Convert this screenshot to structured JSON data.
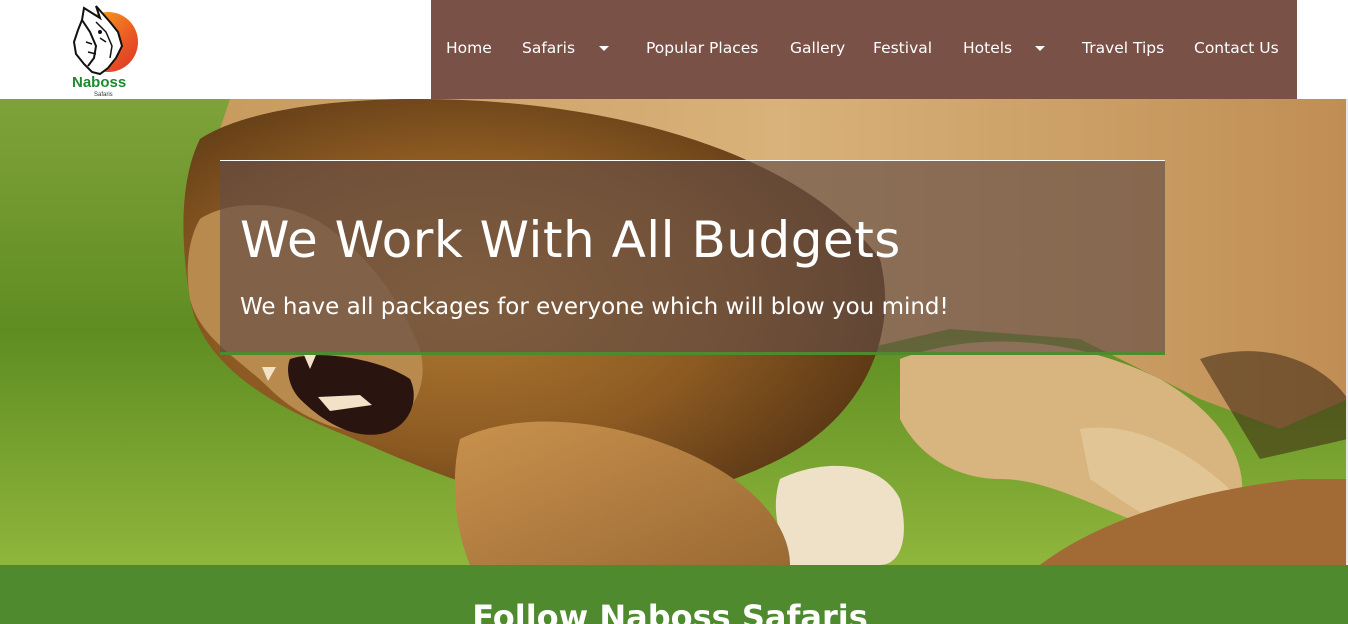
{
  "brand": {
    "name": "Naboss",
    "sub": "Safaris"
  },
  "nav": {
    "items": [
      {
        "label": "Home"
      },
      {
        "label": "Safaris"
      },
      {
        "label": "Popular Places"
      },
      {
        "label": "Gallery"
      },
      {
        "label": "Festival"
      },
      {
        "label": "Hotels"
      },
      {
        "label": "Travel Tips"
      },
      {
        "label": "Contact Us"
      }
    ],
    "dropdown_icon": "caret-down-icon",
    "background_color": "#7a5147"
  },
  "hero": {
    "image": "lions-fighting-on-grass",
    "title": "We Work With All Budgets",
    "subtitle": "We have all packages for everyone which will blow you mind!"
  },
  "follow": {
    "title": "Follow Naboss Safaris",
    "background_color": "#4f8a2e"
  }
}
